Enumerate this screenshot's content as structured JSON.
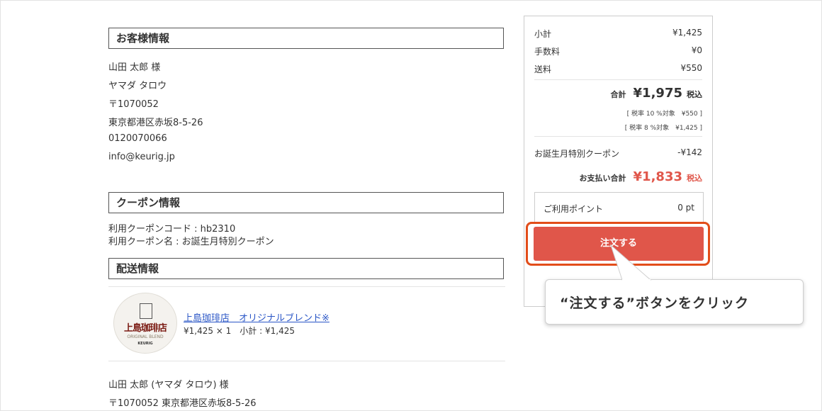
{
  "customer": {
    "heading": "お客様情報",
    "name": "山田 太郎 様",
    "kana": "ヤマダ タロウ",
    "postal": "〒1070052",
    "address": "東京都港区赤坂8-5-26",
    "phone": "0120070066",
    "email": "info@keurig.jp"
  },
  "coupon": {
    "heading": "クーポン情報",
    "code_line": "利用クーポンコード : hb2310",
    "name_line": "利用クーポン名 : お誕生月特別クーポン"
  },
  "delivery": {
    "heading": "配送情報",
    "product_name": "上島珈琲店　オリジナルブレンド※",
    "product_price": "¥1,425 × 1　小計 : ¥1,425",
    "logo_brand": "上島珈琲店",
    "logo_sub": "ORIGINAL BLEND",
    "logo_sub2": "KEURIG",
    "recipient": "山田 太郎 (ヤマダ タロウ) 様",
    "recipient_address": "〒1070052 東京都港区赤坂8-5-26"
  },
  "summary": {
    "subtotal_label": "小計",
    "subtotal_value": "¥1,425",
    "fee_label": "手数料",
    "fee_value": "¥0",
    "shipping_label": "送料",
    "shipping_value": "¥550",
    "total_label": "合計",
    "total_value": "¥1,975",
    "tax_included": "税込",
    "tax10": "[ 税率 10 %対象　¥550 ]",
    "tax8": "[ 税率 8 %対象　¥1,425 ]",
    "coupon_label": "お誕生月特別クーポン",
    "coupon_value": "-¥142",
    "pay_label": "お支払い合計",
    "pay_value": "¥1,833",
    "pay_tax": "税込",
    "points_label": "ご利用ポイント",
    "points_value": "0 pt",
    "order_button": "注文する"
  },
  "tooltip": {
    "text": "“注文する”ボタンをクリック"
  },
  "colors": {
    "accent": "#e0564a",
    "highlight": "#e24d1a",
    "link": "#2a56c6"
  }
}
